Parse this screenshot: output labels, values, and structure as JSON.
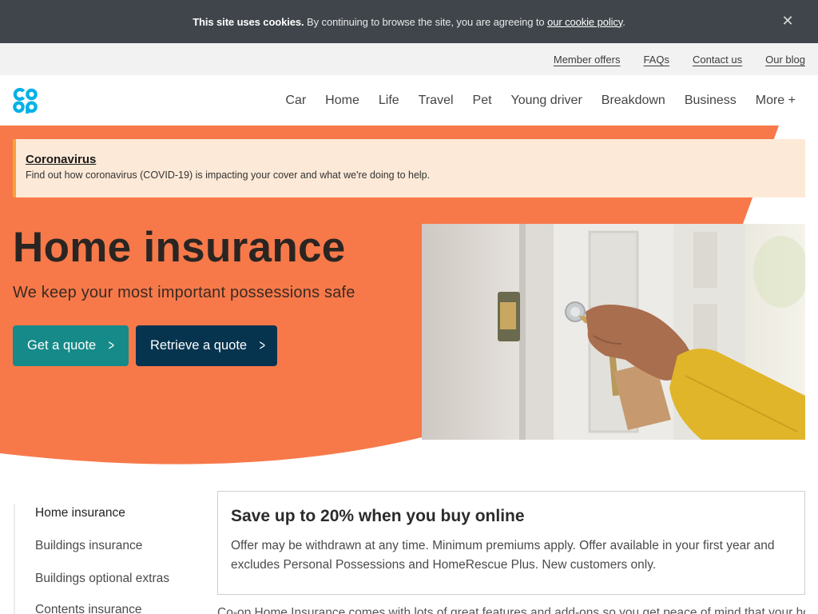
{
  "cookie_bar": {
    "strong_text": "This site uses cookies.",
    "text": " By continuing to browse the site, you are agreeing to ",
    "link": "our cookie policy",
    "end": ".",
    "close_icon": "close-icon",
    "close_glyph": "✕"
  },
  "utility_nav": {
    "items": [
      "Member offers",
      "FAQs",
      "Contact us",
      "Our blog"
    ]
  },
  "logo": {
    "brand": "co-op",
    "color": "#00b1e7"
  },
  "main_nav": {
    "items": [
      "Car",
      "Home",
      "Life",
      "Travel",
      "Pet",
      "Young driver",
      "Breakdown",
      "Business",
      "More +"
    ]
  },
  "alert": {
    "title": "Coronavirus",
    "text": "Find out how coronavirus (COVID-19) is impacting your cover and what we're doing to help."
  },
  "hero": {
    "title": "Home insurance",
    "subtitle": "We keep your most important possessions safe",
    "primary_button": "Get a quote",
    "secondary_button": "Retrieve a quote",
    "chevron_glyph": ">",
    "photo_alt": "Hand with keys unlocking a front door",
    "accent_color": "#f7794a"
  },
  "side_nav": {
    "items": [
      "Home insurance",
      "Buildings insurance",
      "Buildings optional extras",
      "Contents insurance"
    ],
    "active_index": 0
  },
  "offer": {
    "title": "Save up to 20% when you buy online",
    "text": "Offer may be withdrawn at any time. Minimum premiums apply. Offer available in your first year and excludes Personal Possessions and HomeRescue Plus. New customers only."
  },
  "intro": {
    "text": "Co-op Home Insurance comes with lots of great features and add-ons so you get peace of mind that your home is protected"
  }
}
